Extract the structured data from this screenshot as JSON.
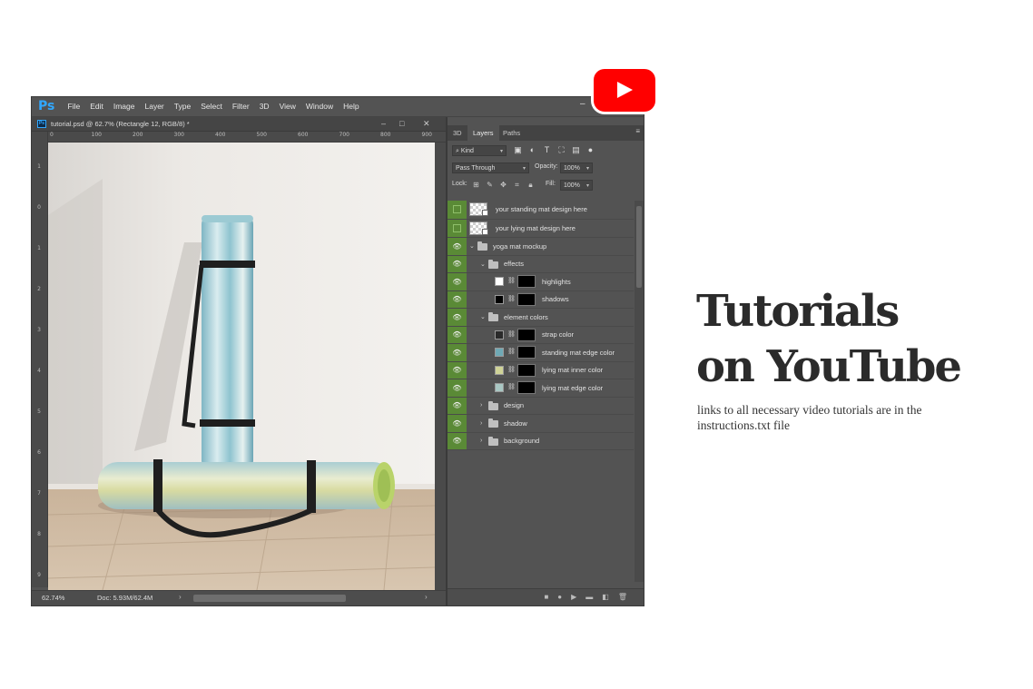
{
  "app": {
    "logo": "Ps",
    "menu": [
      "File",
      "Edit",
      "Image",
      "Layer",
      "Type",
      "Select",
      "Filter",
      "3D",
      "View",
      "Window",
      "Help"
    ],
    "window_controls": [
      "–",
      "□",
      "✕"
    ]
  },
  "document": {
    "tab_title": "tutorial.psd @ 62.7% (Rectangle 12, RGB/8) *",
    "tab_icon": "Ps",
    "ruler_top_labels": [
      "0",
      "100",
      "200",
      "300",
      "400",
      "500",
      "600",
      "700",
      "800",
      "900"
    ],
    "ruler_left_labels": [
      "1",
      "0",
      "1",
      "2",
      "3",
      "4",
      "5",
      "6",
      "7",
      "8",
      "9"
    ],
    "zoom": "62.74%",
    "doc_info": "Doc: 5.93M/62.4M"
  },
  "panel": {
    "tabs": [
      "3D",
      "Layers",
      "Paths"
    ],
    "active_tab": "Layers",
    "filter_kind": "Kind",
    "blend_mode": "Pass Through",
    "opacity_label": "Opacity:",
    "opacity_value": "100%",
    "lock_label": "Lock:",
    "fill_label": "Fill:",
    "fill_value": "100%"
  },
  "layers": [
    {
      "name": "your standing mat design here",
      "type": "smart",
      "visible": false,
      "indent": 0
    },
    {
      "name": "your lying mat design here",
      "type": "smart",
      "visible": false,
      "indent": 0
    },
    {
      "name": "yoga mat mockup",
      "type": "group-open",
      "visible": true,
      "indent": 0
    },
    {
      "name": "effects",
      "type": "group-open",
      "visible": true,
      "indent": 1
    },
    {
      "name": "highlights",
      "type": "fill",
      "color": "#ffffff",
      "visible": true,
      "indent": 2
    },
    {
      "name": "shadows",
      "type": "fill",
      "color": "#000000",
      "visible": true,
      "indent": 2
    },
    {
      "name": "element colors",
      "type": "group-open",
      "visible": true,
      "indent": 1
    },
    {
      "name": "strap color",
      "type": "fill",
      "color": "#2a2a2a",
      "visible": true,
      "indent": 2
    },
    {
      "name": "standing mat edge color",
      "type": "fill",
      "color": "#6fa9b5",
      "visible": true,
      "indent": 2
    },
    {
      "name": "lying mat inner color",
      "type": "fill",
      "color": "#cfd397",
      "visible": true,
      "indent": 2
    },
    {
      "name": "lying mat edge color",
      "type": "fill",
      "color": "#a9c7c3",
      "visible": true,
      "indent": 2
    },
    {
      "name": "design",
      "type": "group-closed",
      "visible": true,
      "indent": 1
    },
    {
      "name": "shadow",
      "type": "group-closed",
      "visible": true,
      "indent": 1
    },
    {
      "name": "background",
      "type": "group-closed",
      "visible": true,
      "indent": 1
    }
  ],
  "promo": {
    "headline_line1": "Tutorials",
    "headline_line2": "on YouTube",
    "subtext": "links to all necessary video tutorials are in the instructions.txt file"
  },
  "colors": {
    "ps_accent": "#31a8ff",
    "eye_green": "#5a8a36",
    "youtube_red": "#ff0000"
  }
}
